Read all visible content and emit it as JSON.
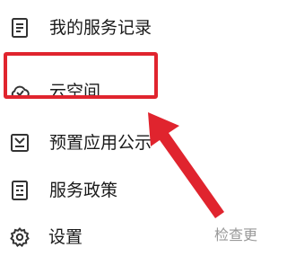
{
  "menu": {
    "items": [
      {
        "label": "我的服务记录",
        "icon": "document-list-icon"
      },
      {
        "label": "云空间",
        "icon": "cloud-icon"
      },
      {
        "label": "预置应用公示",
        "icon": "tray-icon"
      },
      {
        "label": "服务政策",
        "icon": "policy-document-icon"
      },
      {
        "label": "设置",
        "icon": "gear-icon"
      }
    ],
    "check_update_hint": "检查更"
  },
  "annotation": {
    "highlight_color": "#e0242e",
    "arrow_color": "#e0242e",
    "highlighted_item": "云空间"
  },
  "colors": {
    "text": "#1a1a1a",
    "icon": "#333333",
    "hint": "#999999"
  }
}
